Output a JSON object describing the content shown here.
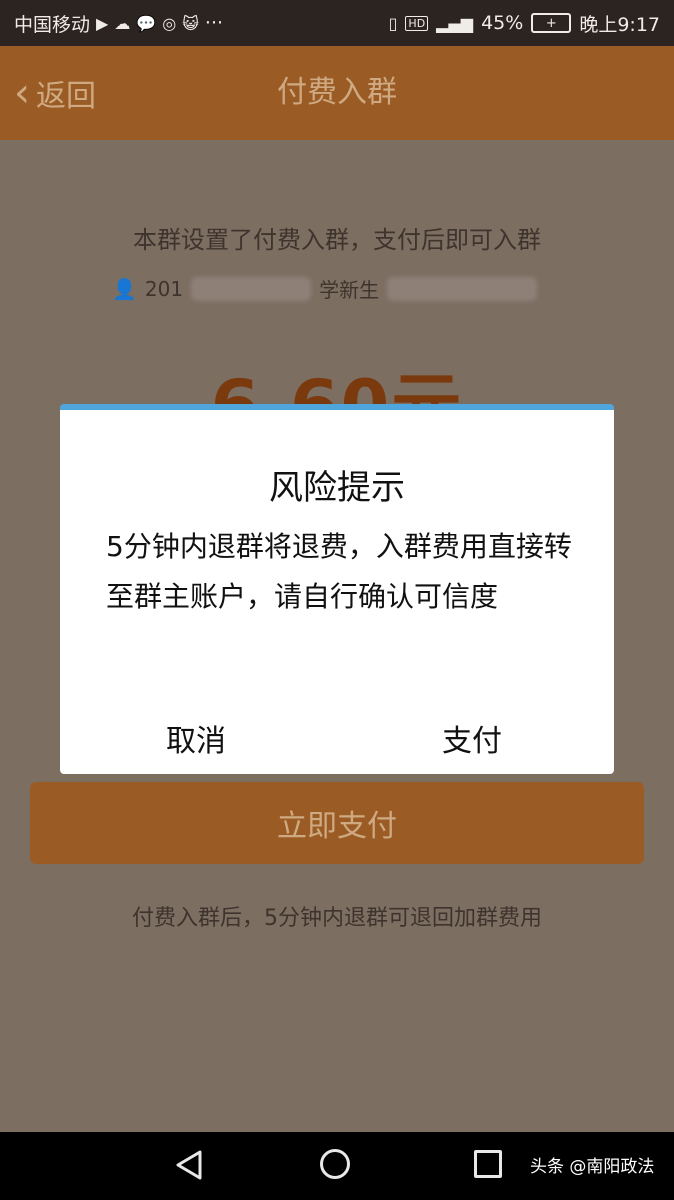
{
  "status_bar": {
    "carrier": "中国移动",
    "more": "···",
    "battery_percent": "45%",
    "time": "晚上9:17",
    "hd_label": "HD"
  },
  "header": {
    "back_label": "返回",
    "title": "付费入群"
  },
  "content": {
    "info_text": "本群设置了付费入群，支付后即可入群",
    "group_name_start": "201",
    "group_name_mid": "学新生",
    "price": "6.60元",
    "pay_button": "立即支付",
    "refund_note": "付费入群后，5分钟内退群可退回加群费用"
  },
  "dialog": {
    "title": "风险提示",
    "message": "5分钟内退群将退费，入群费用直接转至群主账户，请自行确认可信度",
    "cancel_label": "取消",
    "confirm_label": "支付"
  },
  "watermark": {
    "text": "头条 @南阳政法"
  },
  "colors": {
    "header_brown": "#9a5c24",
    "dialog_accent": "#4ea6dc",
    "overlay": "#7d6e62"
  }
}
